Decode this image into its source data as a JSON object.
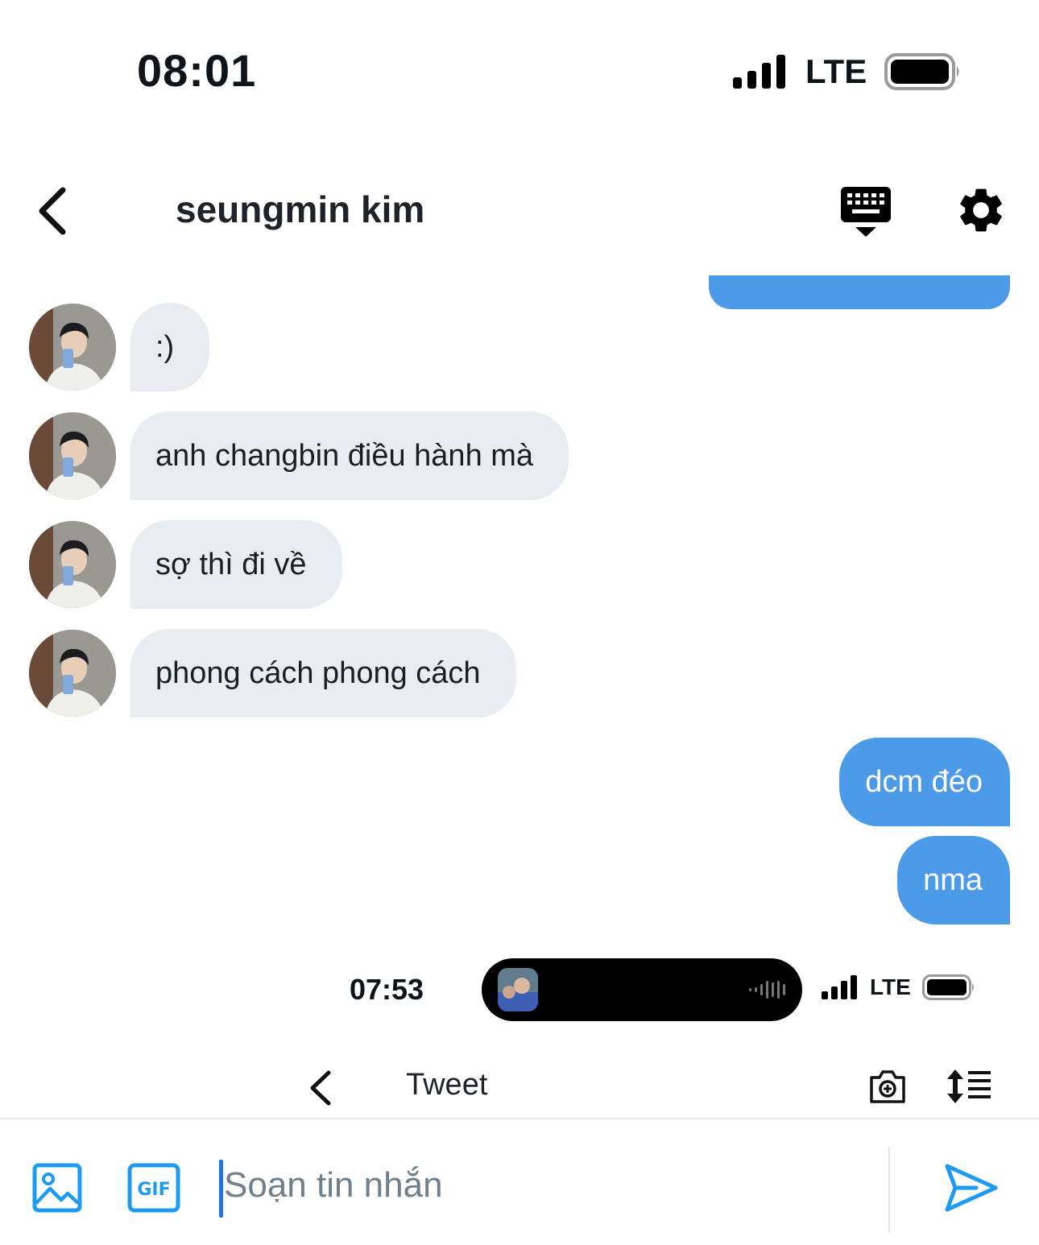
{
  "status_bar": {
    "time": "08:01",
    "network": "LTE"
  },
  "header": {
    "title": "seungmin kim"
  },
  "messages": [
    {
      "direction": "in",
      "text": ":)"
    },
    {
      "direction": "in",
      "text": "anh changbin điều hành mà"
    },
    {
      "direction": "in",
      "text": "sợ thì đi về"
    },
    {
      "direction": "in",
      "text": "phong cách phong cách"
    },
    {
      "direction": "out",
      "text": "dcm đéo"
    },
    {
      "direction": "out",
      "text": "nma"
    }
  ],
  "embedded_screenshot": {
    "time": "07:53",
    "network": "LTE",
    "nav_title": "Tweet"
  },
  "composer": {
    "placeholder": "Soạn tin nhắn"
  },
  "colors": {
    "accent": "#1d9bf0",
    "outgoing_bubble": "#4c9be8",
    "incoming_bubble": "#e9edf1"
  }
}
